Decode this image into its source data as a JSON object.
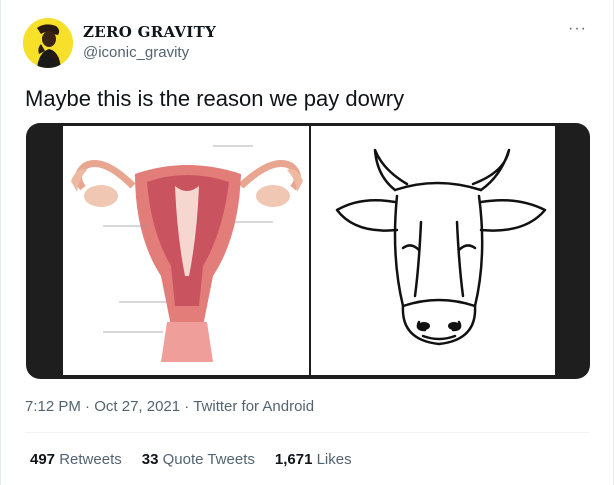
{
  "tweet": {
    "author": {
      "display_name": "ZERO GRAVITY",
      "handle": "@iconic_gravity"
    },
    "more_icon": "ellipsis-icon",
    "text": "Maybe this is the reason we pay dowry",
    "media": {
      "left_image": "uterus-diagram",
      "right_image": "cow-head-drawing"
    },
    "meta": {
      "time": "7:12 PM",
      "dot1": "·",
      "date": "Oct 27, 2021",
      "dot2": "·",
      "source": "Twitter for Android"
    },
    "stats": {
      "retweets_count": "497",
      "retweets_label": "Retweets",
      "quotes_count": "33",
      "quotes_label": "Quote Tweets",
      "likes_count": "1,671",
      "likes_label": "Likes"
    }
  }
}
